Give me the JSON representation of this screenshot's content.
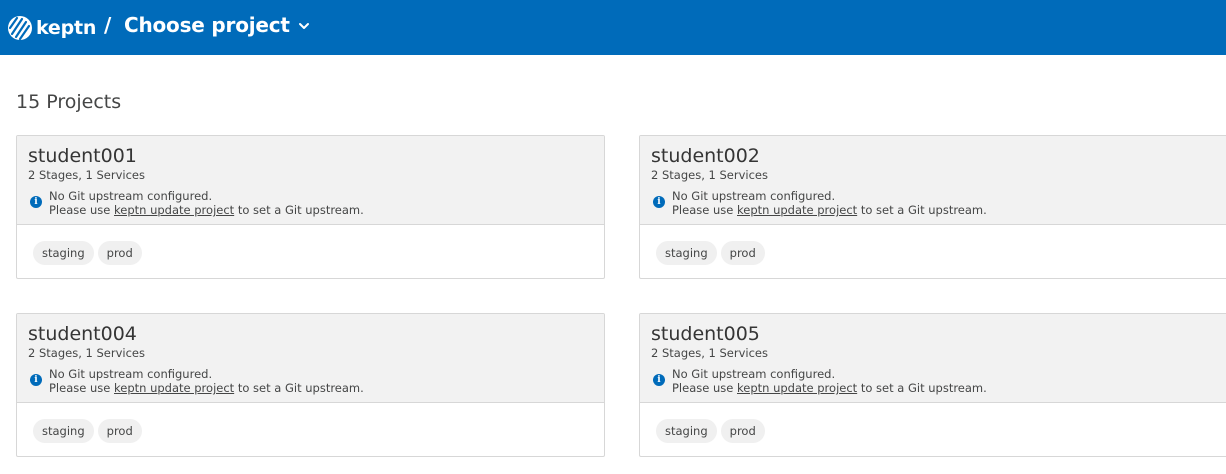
{
  "header": {
    "brand": "keptn",
    "separator": "/",
    "project_selector_label": "Choose project",
    "background_color": "#006bba",
    "logo_icon": "keptn-logo-icon",
    "chevron_icon": "chevron-down-icon"
  },
  "projects_count_label": "15 Projects",
  "info_icon": "info-icon",
  "projects": [
    {
      "name": "student001",
      "summary": "2 Stages, 1 Services",
      "info_line1": "No Git upstream configured.",
      "info_prefix": "Please use ",
      "info_link": "keptn update project",
      "info_suffix": " to set a Git upstream.",
      "stages": [
        "staging",
        "prod"
      ]
    },
    {
      "name": "student002",
      "summary": "2 Stages, 1 Services",
      "info_line1": "No Git upstream configured.",
      "info_prefix": "Please use ",
      "info_link": "keptn update project",
      "info_suffix": " to set a Git upstream.",
      "stages": [
        "staging",
        "prod"
      ]
    },
    {
      "name": "student004",
      "summary": "2 Stages, 1 Services",
      "info_line1": "No Git upstream configured.",
      "info_prefix": "Please use ",
      "info_link": "keptn update project",
      "info_suffix": " to set a Git upstream.",
      "stages": [
        "staging",
        "prod"
      ]
    },
    {
      "name": "student005",
      "summary": "2 Stages, 1 Services",
      "info_line1": "No Git upstream configured.",
      "info_prefix": "Please use ",
      "info_link": "keptn update project",
      "info_suffix": " to set a Git upstream.",
      "stages": [
        "staging",
        "prod"
      ]
    }
  ]
}
